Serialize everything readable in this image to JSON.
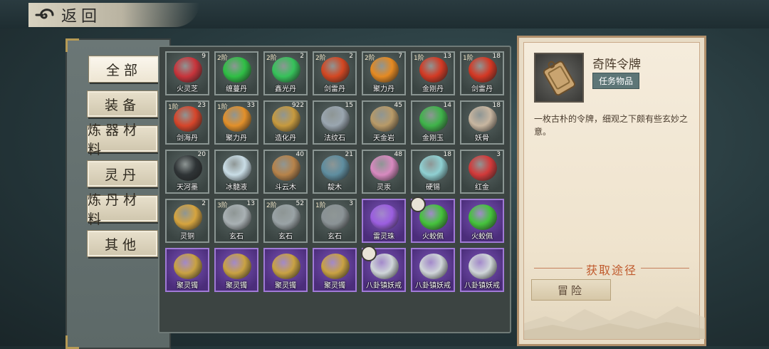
{
  "header": {
    "back_label": "返回"
  },
  "categories": [
    {
      "label": "全部",
      "active": true
    },
    {
      "label": "装备"
    },
    {
      "label": "炼器材料"
    },
    {
      "label": "灵丹"
    },
    {
      "label": "炼丹材料"
    },
    {
      "label": "其他"
    }
  ],
  "items": [
    {
      "name": "火灵芝",
      "tier": "",
      "qty": "9",
      "color": "#c8343b",
      "rare": false
    },
    {
      "name": "缠蔓丹",
      "tier": "2阶",
      "qty": "",
      "color": "#2fbf45",
      "rare": false
    },
    {
      "name": "鑫光丹",
      "tier": "2阶",
      "qty": "2",
      "color": "#36c25a",
      "rare": false
    },
    {
      "name": "剑雷丹",
      "tier": "2阶",
      "qty": "2",
      "color": "#d34722",
      "rare": false
    },
    {
      "name": "聚力丹",
      "tier": "2阶",
      "qty": "7",
      "color": "#e58a22",
      "rare": false
    },
    {
      "name": "金刚丹",
      "tier": "1阶",
      "qty": "13",
      "color": "#d33a24",
      "rare": false
    },
    {
      "name": "剑雷丹",
      "tier": "1阶",
      "qty": "18",
      "color": "#d43824",
      "rare": false
    },
    {
      "name": "剑海丹",
      "tier": "1阶",
      "qty": "23",
      "color": "#d6452a",
      "rare": false
    },
    {
      "name": "聚力丹",
      "tier": "1阶",
      "qty": "33",
      "color": "#e2902a",
      "rare": false
    },
    {
      "name": "造化丹",
      "tier": "",
      "qty": "922",
      "color": "#c79a3e",
      "rare": false
    },
    {
      "name": "法纹石",
      "tier": "",
      "qty": "15",
      "color": "#9aa6b0",
      "rare": false
    },
    {
      "name": "天金岩",
      "tier": "",
      "qty": "45",
      "color": "#b89a68",
      "rare": false
    },
    {
      "name": "金刚玉",
      "tier": "",
      "qty": "14",
      "color": "#3fb34a",
      "rare": false
    },
    {
      "name": "妖骨",
      "tier": "",
      "qty": "18",
      "color": "#c8b6a0",
      "rare": false
    },
    {
      "name": "天河墨",
      "tier": "",
      "qty": "20",
      "color": "#2f3436",
      "rare": false
    },
    {
      "name": "冰髓液",
      "tier": "",
      "qty": "",
      "color": "#c9dde6",
      "rare": false
    },
    {
      "name": "斗云木",
      "tier": "",
      "qty": "40",
      "color": "#b7834a",
      "rare": false
    },
    {
      "name": "靛木",
      "tier": "",
      "qty": "21",
      "color": "#5f8ea0",
      "rare": false
    },
    {
      "name": "灵汞",
      "tier": "",
      "qty": "48",
      "color": "#d88ac0",
      "rare": false
    },
    {
      "name": "硬锡",
      "tier": "",
      "qty": "18",
      "color": "#8fd0d2",
      "rare": false
    },
    {
      "name": "红金",
      "tier": "",
      "qty": "3",
      "color": "#d23a3a",
      "rare": false
    },
    {
      "name": "灵铜",
      "tier": "",
      "qty": "2",
      "color": "#d6a43e",
      "rare": false
    },
    {
      "name": "玄石",
      "tier": "3阶",
      "qty": "13",
      "color": "#a9b1b4",
      "rare": false
    },
    {
      "name": "玄石",
      "tier": "2阶",
      "qty": "52",
      "color": "#9aa3a6",
      "rare": false
    },
    {
      "name": "玄石",
      "tier": "1阶",
      "qty": "3",
      "color": "#8b9396",
      "rare": false
    },
    {
      "name": "雷灵珠",
      "tier": "",
      "qty": "",
      "color": "#9b5ee0",
      "rare": true
    },
    {
      "name": "火蛟佩",
      "tier": "",
      "qty": "",
      "color": "#45c33c",
      "rare": true
    },
    {
      "name": "火蛟佩",
      "tier": "",
      "qty": "",
      "color": "#45c33c",
      "rare": true
    },
    {
      "name": "聚灵镯",
      "tier": "",
      "qty": "",
      "color": "#c9a243",
      "rare": true
    },
    {
      "name": "聚灵镯",
      "tier": "",
      "qty": "",
      "color": "#c9a243",
      "rare": true
    },
    {
      "name": "聚灵镯",
      "tier": "",
      "qty": "",
      "color": "#c9a243",
      "rare": true
    },
    {
      "name": "聚灵镯",
      "tier": "",
      "qty": "",
      "color": "#c9a243",
      "rare": true
    },
    {
      "name": "八卦镇妖戒",
      "tier": "",
      "qty": "",
      "color": "#d0d6d9",
      "rare": true
    },
    {
      "name": "八卦镇妖戒",
      "tier": "",
      "qty": "",
      "color": "#d0d6d9",
      "rare": true
    },
    {
      "name": "八卦镇妖戒",
      "tier": "",
      "qty": "",
      "color": "#d0d6d9",
      "rare": true
    }
  ],
  "detail": {
    "title": "奇阵令牌",
    "type": "任务物品",
    "description": "一枚古朴的令牌，细观之下颇有些玄妙之意。",
    "acquire_title": "获取途径",
    "acquire_button": "冒险"
  }
}
